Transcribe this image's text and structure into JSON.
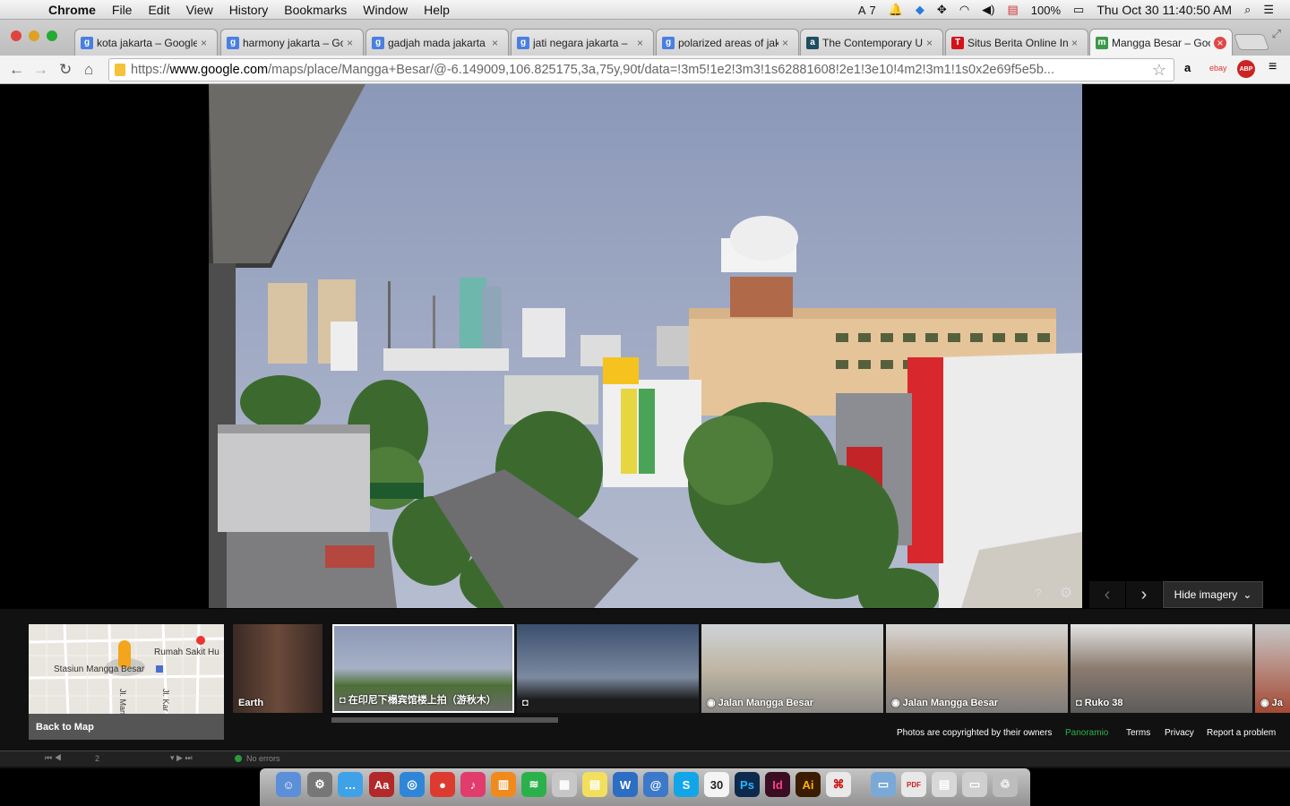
{
  "menubar": {
    "app": "Chrome",
    "items": [
      "File",
      "Edit",
      "View",
      "History",
      "Bookmarks",
      "Window",
      "Help"
    ],
    "adobe_count": "7",
    "battery": "100%",
    "clock": "Thu Oct 30  11:40:50 AM"
  },
  "tabs": [
    {
      "title": "kota jakarta – Google",
      "icon": "google-icon",
      "color": "#4a7fe0",
      "letter": "g"
    },
    {
      "title": "harmony jakarta – Google",
      "icon": "google-icon",
      "color": "#4a7fe0",
      "letter": "g"
    },
    {
      "title": "gadjah mada jakarta",
      "icon": "google-icon",
      "color": "#4a7fe0",
      "letter": "g"
    },
    {
      "title": "jati negara jakarta –",
      "icon": "google-icon",
      "color": "#4a7fe0",
      "letter": "g"
    },
    {
      "title": "polarized areas of jakarta",
      "icon": "google-icon",
      "color": "#4a7fe0",
      "letter": "g"
    },
    {
      "title": "The Contemporary Urban",
      "icon": "academia-icon",
      "color": "#1f4e5f",
      "letter": "a"
    },
    {
      "title": "Situs Berita Online Indonesia",
      "icon": "tempo-icon",
      "color": "#d2141a",
      "letter": "T"
    },
    {
      "title": "Mangga Besar – Google Maps",
      "icon": "maps-icon",
      "color": "#3a9a4a",
      "letter": "m"
    }
  ],
  "address": {
    "prefix": "https://",
    "host": "www.google.com",
    "path": "/maps/place/Mangga+Besar/@-6.149009,106.825175,3a,75y,90t/data=!3m5!1e2!3m3!1s62881608!2e1!3e10!4m2!3m1!1s0x2e69f5e5b..."
  },
  "extensions": [
    "a",
    "ebay",
    "ABP"
  ],
  "viewer": {
    "hide_label": "Hide imagery"
  },
  "mapcard": {
    "label1": "Rumah Sakit Hu",
    "label2": "Stasiun Mangga Besar",
    "label3": "Jl. Mang",
    "label4": "Jl. Kar",
    "back": "Back to Map"
  },
  "thumbs": [
    {
      "caption": "Earth",
      "icon": ""
    },
    {
      "caption": "在印尼下榻宾馆楼上拍（游秋木）",
      "icon": "camera-icon"
    },
    {
      "caption": "",
      "icon": "camera-icon"
    },
    {
      "caption": "Jalan Mangga Besar",
      "icon": "streetview-icon"
    },
    {
      "caption": "Jalan Mangga Besar",
      "icon": "streetview-icon"
    },
    {
      "caption": "Ruko 38",
      "icon": "camera-icon"
    },
    {
      "caption": "Ja",
      "icon": "streetview-icon"
    }
  ],
  "footer": {
    "copyright": "Photos are copyrighted by their owners",
    "panoramio": "Panoramio",
    "terms": "Terms",
    "privacy": "Privacy",
    "report": "Report a problem"
  },
  "status": {
    "page": "2",
    "errors": "No errors"
  },
  "dock_date": "30"
}
